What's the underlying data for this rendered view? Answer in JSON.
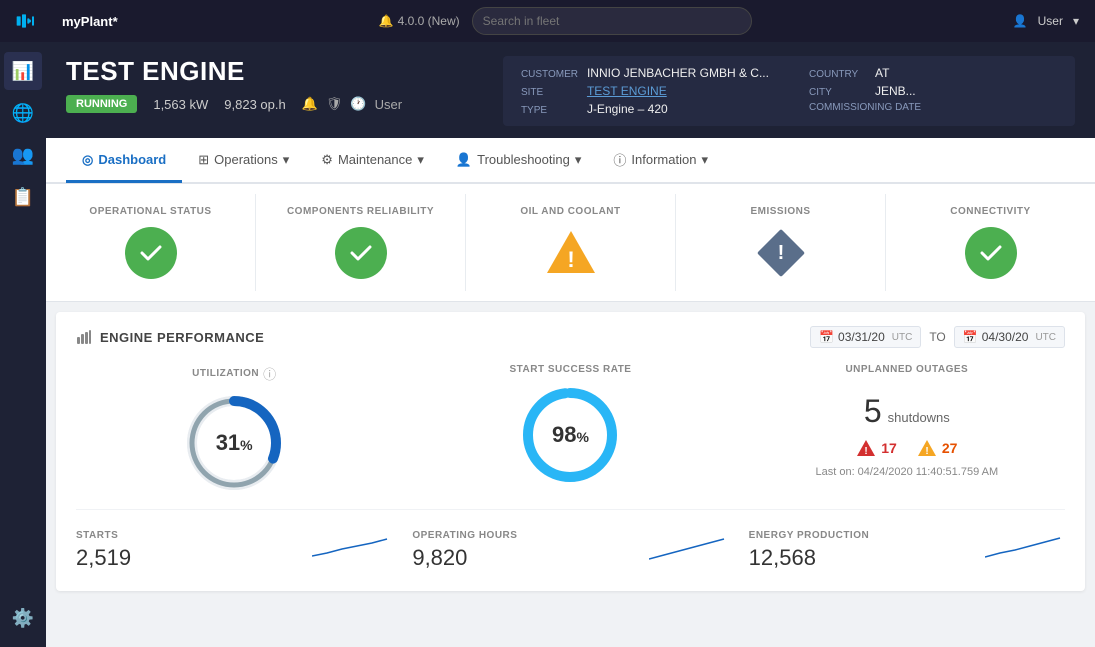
{
  "topnav": {
    "logo_text": "myPlant*",
    "notification": "4.0.0 (New)",
    "search_placeholder": "Search in fleet",
    "user_label": "User"
  },
  "sidebar": {
    "items": [
      {
        "id": "chart",
        "icon": "📊"
      },
      {
        "id": "globe",
        "icon": "🌐"
      },
      {
        "id": "people",
        "icon": "👥"
      },
      {
        "id": "doc",
        "icon": "📋"
      },
      {
        "id": "gear",
        "icon": "⚙️"
      }
    ]
  },
  "engine": {
    "title": "TEST ENGINE",
    "status": "RUNNING",
    "power": "1,563 kW",
    "hours": "9,823 op.h",
    "user": "User",
    "customer_label": "CUSTOMER",
    "customer_value": "INNIO JENBACHER GMBH & C...",
    "site_label": "SITE",
    "site_value": "TEST ENGINE",
    "type_label": "TYPE",
    "type_value": "J-Engine – 420",
    "country_label": "COUNTRY",
    "country_value": "AT",
    "city_label": "CITY",
    "city_value": "JENB...",
    "commissioning_label": "COMMISSIONING DATE",
    "commissioning_value": ""
  },
  "tabs": [
    {
      "id": "dashboard",
      "label": "Dashboard",
      "active": true
    },
    {
      "id": "operations",
      "label": "Operations",
      "has_arrow": true
    },
    {
      "id": "maintenance",
      "label": "Maintenance",
      "has_arrow": true
    },
    {
      "id": "troubleshooting",
      "label": "Troubleshooting",
      "has_arrow": true
    },
    {
      "id": "information",
      "label": "Information",
      "has_arrow": true
    }
  ],
  "status_cards": [
    {
      "id": "operational",
      "label": "OPERATIONAL STATUS",
      "status": "green"
    },
    {
      "id": "components",
      "label": "COMPONENTS RELIABILITY",
      "status": "green"
    },
    {
      "id": "oil",
      "label": "OIL AND COOLANT",
      "status": "warning-triangle"
    },
    {
      "id": "emissions",
      "label": "EMISSIONS",
      "status": "warning-diamond"
    },
    {
      "id": "connectivity",
      "label": "CONNECTIVITY",
      "status": "green"
    }
  ],
  "performance": {
    "title": "ENGINE PERFORMANCE",
    "date_from": "03/31/20",
    "date_to": "04/30/20",
    "utc_label": "UTC",
    "to_label": "TO",
    "utilization": {
      "label": "UTILIZATION",
      "value": "31",
      "pct": "%",
      "percent": 31
    },
    "start_success": {
      "label": "START SUCCESS RATE",
      "value": "98",
      "pct": "%",
      "percent": 98
    },
    "outages": {
      "label": "UNPLANNED OUTAGES",
      "shutdowns": "5",
      "shutdowns_label": "shutdowns",
      "alert_red_count": "17",
      "alert_orange_count": "27",
      "last_on_label": "Last on: 04/24/2020 11:40:51.759 AM"
    },
    "starts": {
      "label": "STARTS",
      "value": "2,519"
    },
    "operating_hours": {
      "label": "OPERATING HOURS",
      "value": "9,820"
    },
    "energy": {
      "label": "ENERGY PRODUCTION",
      "value": "12,568"
    }
  }
}
